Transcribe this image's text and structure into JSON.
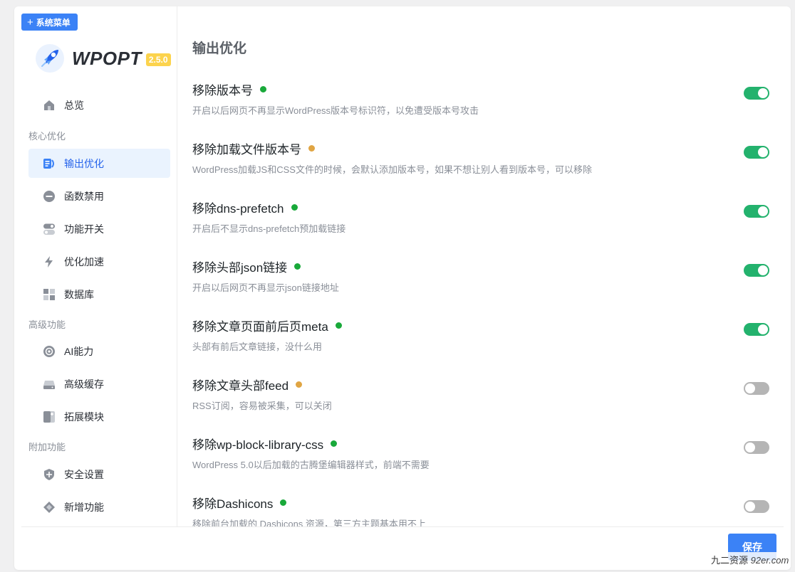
{
  "sidebar": {
    "system_menu_label": "系统菜单",
    "logo_name": "WPOPT",
    "version": "2.5.0",
    "items": [
      {
        "label": "总览",
        "icon": "home-icon"
      },
      {
        "section": "核心优化"
      },
      {
        "label": "输出优化",
        "icon": "output-icon",
        "active": true
      },
      {
        "label": "函数禁用",
        "icon": "minus-circle-icon"
      },
      {
        "label": "功能开关",
        "icon": "switch-icon"
      },
      {
        "label": "优化加速",
        "icon": "lightning-icon"
      },
      {
        "label": "数据库",
        "icon": "database-icon"
      },
      {
        "section": "高级功能"
      },
      {
        "label": "AI能力",
        "icon": "ai-icon"
      },
      {
        "label": "高级缓存",
        "icon": "cache-icon"
      },
      {
        "label": "拓展模块",
        "icon": "module-icon"
      },
      {
        "section": "附加功能"
      },
      {
        "label": "安全设置",
        "icon": "shield-icon"
      },
      {
        "label": "新增功能",
        "icon": "diamond-icon"
      }
    ]
  },
  "main": {
    "title": "输出优化",
    "options": [
      {
        "title": "移除版本号",
        "dot": "#19a93a",
        "desc": "开启以后网页不再显示WordPress版本号标识符，以免遭受版本号攻击",
        "enabled": true
      },
      {
        "title": "移除加载文件版本号",
        "dot": "#e0a543",
        "desc": "WordPress加载JS和CSS文件的时候，会默认添加版本号，如果不想让别人看到版本号，可以移除",
        "enabled": true
      },
      {
        "title": "移除dns-prefetch",
        "dot": "#19a93a",
        "desc": "开启后不显示dns-prefetch预加载链接",
        "enabled": true
      },
      {
        "title": "移除头部json链接",
        "dot": "#19a93a",
        "desc": "开启以后网页不再显示json链接地址",
        "enabled": true
      },
      {
        "title": "移除文章页面前后页meta",
        "dot": "#19a93a",
        "desc": "头部有前后文章链接，没什么用",
        "enabled": true
      },
      {
        "title": "移除文章头部feed",
        "dot": "#e0a543",
        "desc": "RSS订阅，容易被采集，可以关闭",
        "enabled": false
      },
      {
        "title": "移除wp-block-library-css",
        "dot": "#19a93a",
        "desc": "WordPress 5.0以后加载的古腾堡编辑器样式，前端不需要",
        "enabled": false
      },
      {
        "title": "移除Dashicons",
        "dot": "#19a93a",
        "desc": "移除前台加载的 Dashicons 资源，第三方主题基本用不上",
        "enabled": false
      }
    ]
  },
  "footer": {
    "save_label": "保存"
  },
  "watermark": {
    "text": "九二资源",
    "domain": "92er.com"
  }
}
